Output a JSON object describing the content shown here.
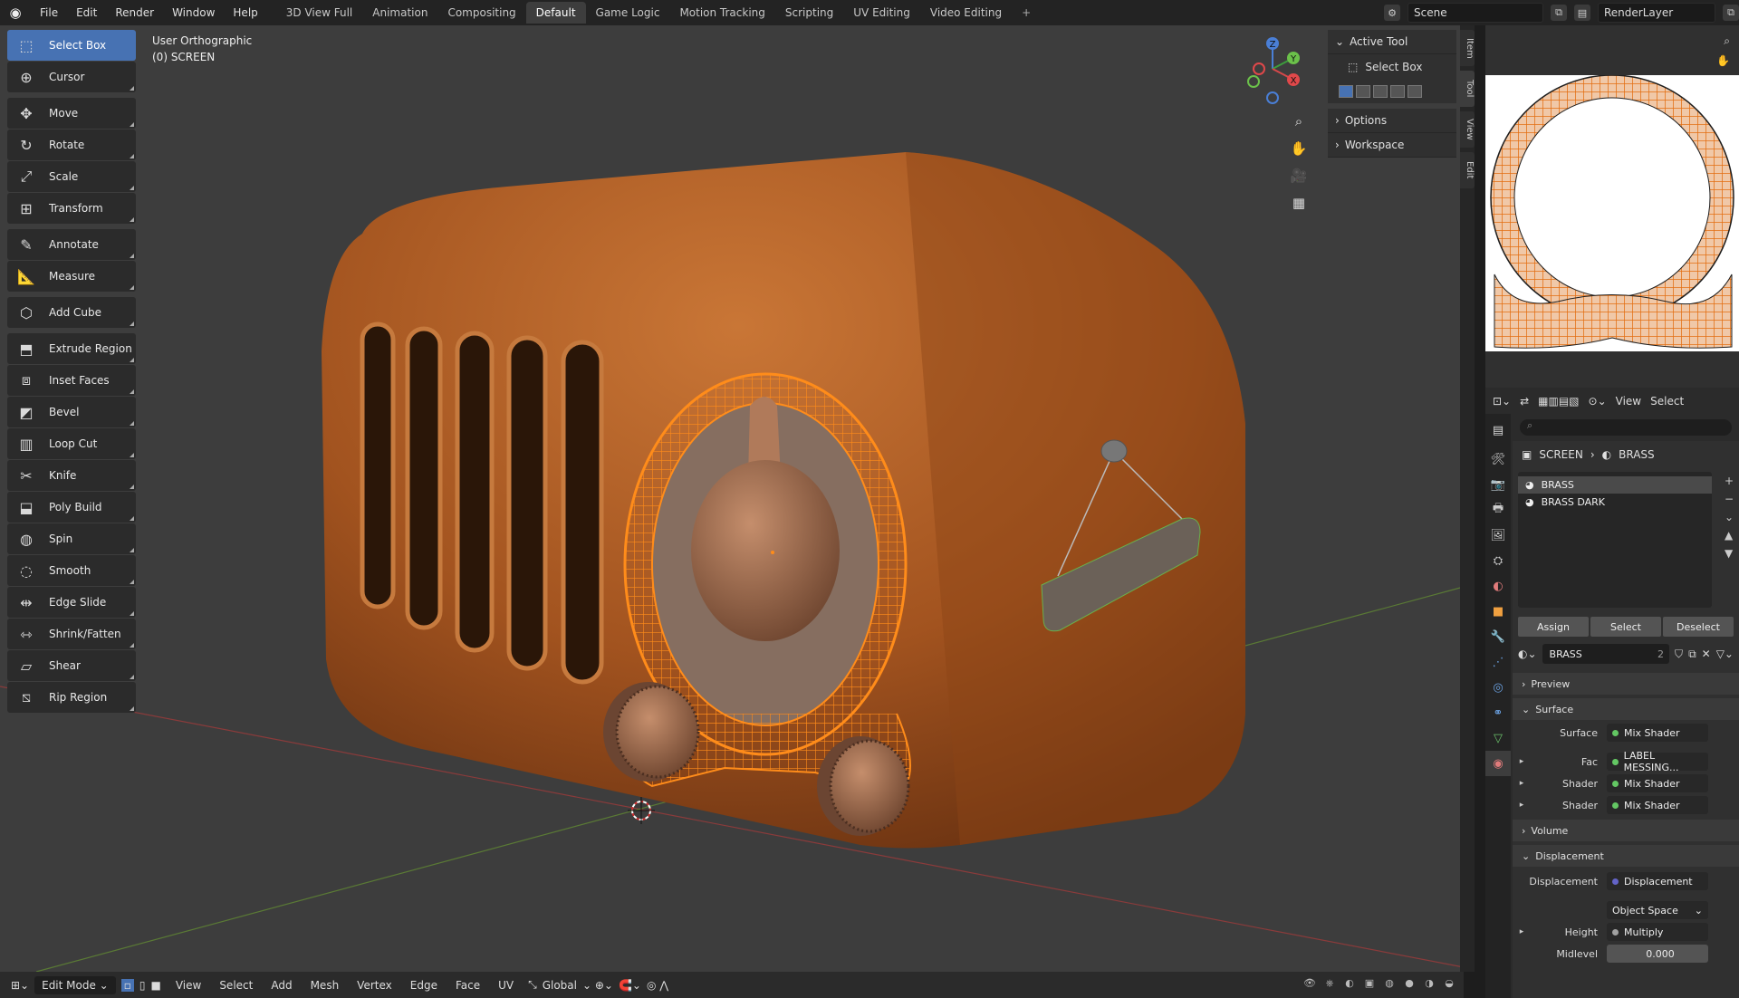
{
  "menubar": {
    "items": [
      "File",
      "Edit",
      "Render",
      "Window",
      "Help"
    ],
    "workspaces": [
      "3D View Full",
      "Animation",
      "Compositing",
      "Default",
      "Game Logic",
      "Motion Tracking",
      "Scripting",
      "UV Editing",
      "Video Editing"
    ],
    "active_workspace": "Default",
    "add_workspace": "+",
    "scene": "Scene",
    "render_layer": "RenderLayer"
  },
  "viewport": {
    "view_name": "User Orthographic",
    "object_name": "(0) SCREEN",
    "gizmo_axes": {
      "x": "X",
      "y": "Y",
      "z": "Z"
    }
  },
  "toolbar": [
    {
      "label": "Select Box",
      "icon": "select-box-icon"
    },
    {
      "label": "Cursor",
      "icon": "cursor-icon"
    },
    {
      "label": "Move",
      "icon": "move-icon"
    },
    {
      "label": "Rotate",
      "icon": "rotate-icon"
    },
    {
      "label": "Scale",
      "icon": "scale-icon"
    },
    {
      "label": "Transform",
      "icon": "transform-icon"
    },
    {
      "label": "Annotate",
      "icon": "annotate-icon"
    },
    {
      "label": "Measure",
      "icon": "measure-icon"
    },
    {
      "label": "Add Cube",
      "icon": "add-cube-icon"
    },
    {
      "label": "Extrude Region",
      "icon": "extrude-icon"
    },
    {
      "label": "Inset Faces",
      "icon": "inset-icon"
    },
    {
      "label": "Bevel",
      "icon": "bevel-icon"
    },
    {
      "label": "Loop Cut",
      "icon": "loop-cut-icon"
    },
    {
      "label": "Knife",
      "icon": "knife-icon"
    },
    {
      "label": "Poly Build",
      "icon": "poly-build-icon"
    },
    {
      "label": "Spin",
      "icon": "spin-icon"
    },
    {
      "label": "Smooth",
      "icon": "smooth-icon"
    },
    {
      "label": "Edge Slide",
      "icon": "edge-slide-icon"
    },
    {
      "label": "Shrink/Fatten",
      "icon": "shrink-fatten-icon"
    },
    {
      "label": "Shear",
      "icon": "shear-icon"
    },
    {
      "label": "Rip Region",
      "icon": "rip-region-icon"
    }
  ],
  "npanel": {
    "active_tool_header": "Active Tool",
    "active_tool_name": "Select Box",
    "options": "Options",
    "workspace": "Workspace",
    "tabs": [
      "Item",
      "Tool",
      "View",
      "Edit"
    ]
  },
  "bottombar": {
    "mode": "Edit Mode",
    "menus": [
      "View",
      "Select",
      "Add",
      "Mesh",
      "Vertex",
      "Edge",
      "Face",
      "UV"
    ],
    "orientation": "Global"
  },
  "uv_editor": {
    "menus": [
      "View",
      "Select"
    ]
  },
  "properties": {
    "breadcrumb_object": "SCREEN",
    "breadcrumb_material": "BRASS",
    "slots": [
      "BRASS",
      "BRASS DARK"
    ],
    "buttons": [
      "Assign",
      "Select",
      "Deselect"
    ],
    "material_name": "BRASS",
    "user_count": "2",
    "sections": {
      "preview": "Preview",
      "surface": "Surface",
      "volume": "Volume",
      "displacement": "Displacement"
    },
    "surface_rows": [
      {
        "label": "Surface",
        "value": "Mix Shader",
        "arrow": ""
      },
      {
        "label": "Fac",
        "value": "LABEL MESSING...",
        "arrow": "▸"
      },
      {
        "label": "Shader",
        "value": "Mix Shader",
        "arrow": "▸"
      },
      {
        "label": "Shader",
        "value": "Mix Shader",
        "arrow": "▸"
      }
    ],
    "displacement_rows": {
      "displacement_label": "Displacement",
      "displacement_value": "Displacement",
      "space": "Object Space",
      "height_label": "Height",
      "height_value": "Multiply",
      "midlevel_label": "Midlevel",
      "midlevel_value": "0.000"
    }
  },
  "colors": {
    "accent": "#4772b3",
    "radio_body": "#a85a28",
    "selection": "#ff8c1a",
    "shader_socket": "#63c763"
  }
}
